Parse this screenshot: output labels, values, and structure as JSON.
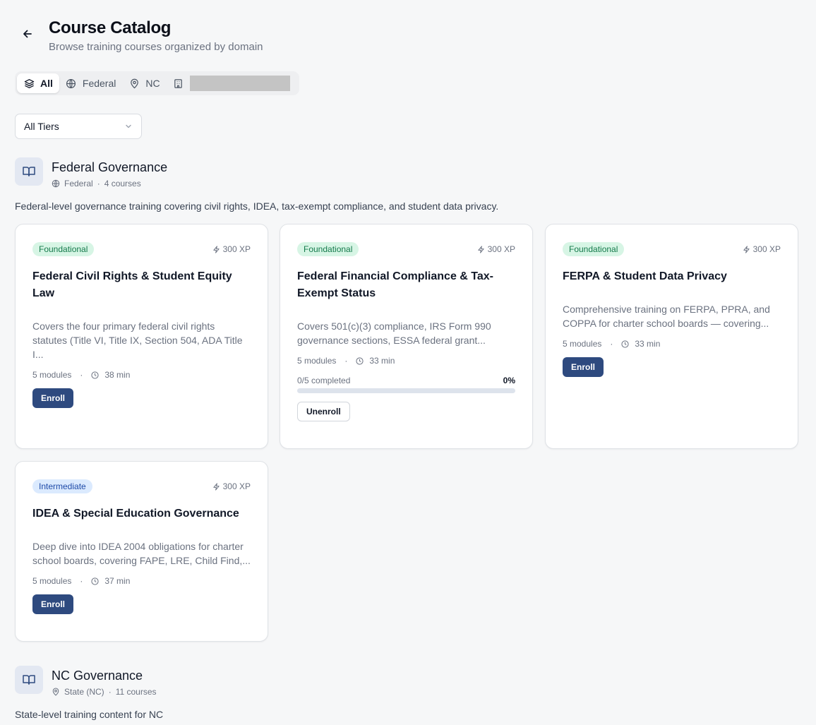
{
  "header": {
    "title": "Course Catalog",
    "subtitle": "Browse training courses organized by domain"
  },
  "filter_tabs": [
    {
      "label": "All",
      "icon": "layers-icon",
      "active": true
    },
    {
      "label": "Federal",
      "icon": "globe-icon",
      "active": false
    },
    {
      "label": "NC",
      "icon": "map-pin-icon",
      "active": false
    },
    {
      "label": "",
      "icon": "building-icon",
      "active": false,
      "redacted": true
    }
  ],
  "tier_filter": {
    "selected": "All Tiers"
  },
  "domains": [
    {
      "title": "Federal Governance",
      "scope": "Federal",
      "scope_icon": "globe-icon",
      "count": "4 courses",
      "description": "Federal-level governance training covering civil rights, IDEA, tax-exempt compliance, and student data privacy.",
      "courses": [
        {
          "tier": "Foundational",
          "xp": "300 XP",
          "title": "Federal Civil Rights & Student Equity Law",
          "description": "Covers the four primary federal civil rights statutes (Title VI, Title IX, Section 504, ADA Title I...",
          "modules": "5 modules",
          "duration": "38 min",
          "action": "Enroll"
        },
        {
          "tier": "Foundational",
          "xp": "300 XP",
          "title": "Federal Financial Compliance & Tax-Exempt Status",
          "description": "Covers 501(c)(3) compliance, IRS Form 990 governance sections, ESSA federal grant...",
          "modules": "5 modules",
          "duration": "33 min",
          "progress_label": "0/5 completed",
          "progress_pct": "0%",
          "progress_value": 0,
          "action": "Unenroll"
        },
        {
          "tier": "Foundational",
          "xp": "300 XP",
          "title": "FERPA & Student Data Privacy",
          "description": "Comprehensive training on FERPA, PPRA, and COPPA for charter school boards — covering...",
          "modules": "5 modules",
          "duration": "33 min",
          "action": "Enroll"
        },
        {
          "tier": "Intermediate",
          "xp": "300 XP",
          "title": "IDEA & Special Education Governance",
          "description": "Deep dive into IDEA 2004 obligations for charter school boards, covering FAPE, LRE, Child Find,...",
          "modules": "5 modules",
          "duration": "37 min",
          "action": "Enroll"
        }
      ]
    },
    {
      "title": "NC Governance",
      "scope": "State (NC)",
      "scope_icon": "map-pin-icon",
      "count": "11 courses",
      "description": "State-level training content for NC"
    }
  ],
  "separator": "·",
  "colors": {
    "accent": "#2e4a7f",
    "foundational_bg": "#d7f5e5",
    "foundational_text": "#147a4b",
    "intermediate_bg": "#dbeafe",
    "intermediate_text": "#1e4aa8"
  }
}
